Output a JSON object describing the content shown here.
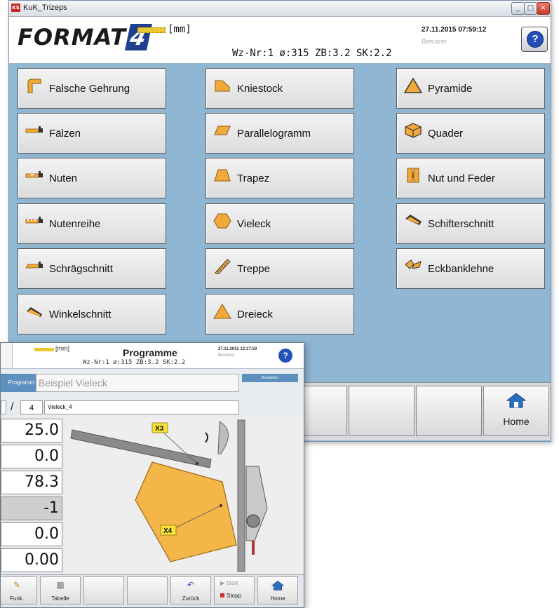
{
  "main_window": {
    "title": "KuK_Trizeps",
    "logo": {
      "text": "FORMAT",
      "number": "4"
    },
    "unit": "[mm]",
    "wz_info": "Wz-Nr:1 ø:315 ZB:3.2 SK:2.2",
    "datetime": "27.11.2015 07:59:12",
    "user": "Benutzer",
    "help_label": "?",
    "menu_items": [
      {
        "label": "Falsche Gehrung",
        "icon": "falsche-gehrung-icon"
      },
      {
        "label": "Kniestock",
        "icon": "kniestock-icon"
      },
      {
        "label": "Pyramide",
        "icon": "pyramide-icon"
      },
      {
        "label": "Fälzen",
        "icon": "faelzen-icon"
      },
      {
        "label": "Parallelogramm",
        "icon": "parallelogramm-icon"
      },
      {
        "label": "Quader",
        "icon": "quader-icon"
      },
      {
        "label": "Nuten",
        "icon": "nuten-icon"
      },
      {
        "label": "Trapez",
        "icon": "trapez-icon"
      },
      {
        "label": "Nut und Feder",
        "icon": "nut-feder-icon"
      },
      {
        "label": "Nutenreihe",
        "icon": "nutenreihe-icon"
      },
      {
        "label": "Vieleck",
        "icon": "vieleck-icon"
      },
      {
        "label": "Schifterschnitt",
        "icon": "schifterschnitt-icon"
      },
      {
        "label": "Schrägschnitt",
        "icon": "schraegschnitt-icon"
      },
      {
        "label": "Treppe",
        "icon": "treppe-icon"
      },
      {
        "label": "Eckbanklehne",
        "icon": "eckbanklehne-icon"
      },
      {
        "label": "Winkelschnitt",
        "icon": "winkelschnitt-icon"
      },
      {
        "label": "Dreieck",
        "icon": "dreieck-icon"
      }
    ],
    "home_label": "Home"
  },
  "overlay_window": {
    "unit": "[mm]",
    "title": "Programme",
    "wz_info": "Wz-Nr:1 ø:315 ZB:3.2 SK:2.2",
    "datetime": "27.11.2015 12:37:50",
    "user": "Benutzer",
    "help_label": "?",
    "program_label": "Programm",
    "program_name": "Beispiel Vieleck",
    "bearbeiten_label": "Bearbeiten",
    "slash": "/",
    "step_count": "4",
    "step_name": "Vieleck_4",
    "values": [
      "25.0",
      "0.0",
      "78.3",
      "-1",
      "0.0",
      "0.00"
    ],
    "diagram_labels": {
      "x3": "X3",
      "x4": "X4"
    },
    "buttons": {
      "funk": "Funk.",
      "tabelle": "Tabelle",
      "zurueck": "Zurück",
      "start": "Start",
      "stopp": "Stopp",
      "home": "Home"
    }
  },
  "colors": {
    "background": "#8fb6d3",
    "accent": "#f2a93b",
    "blue": "#2451b8"
  }
}
